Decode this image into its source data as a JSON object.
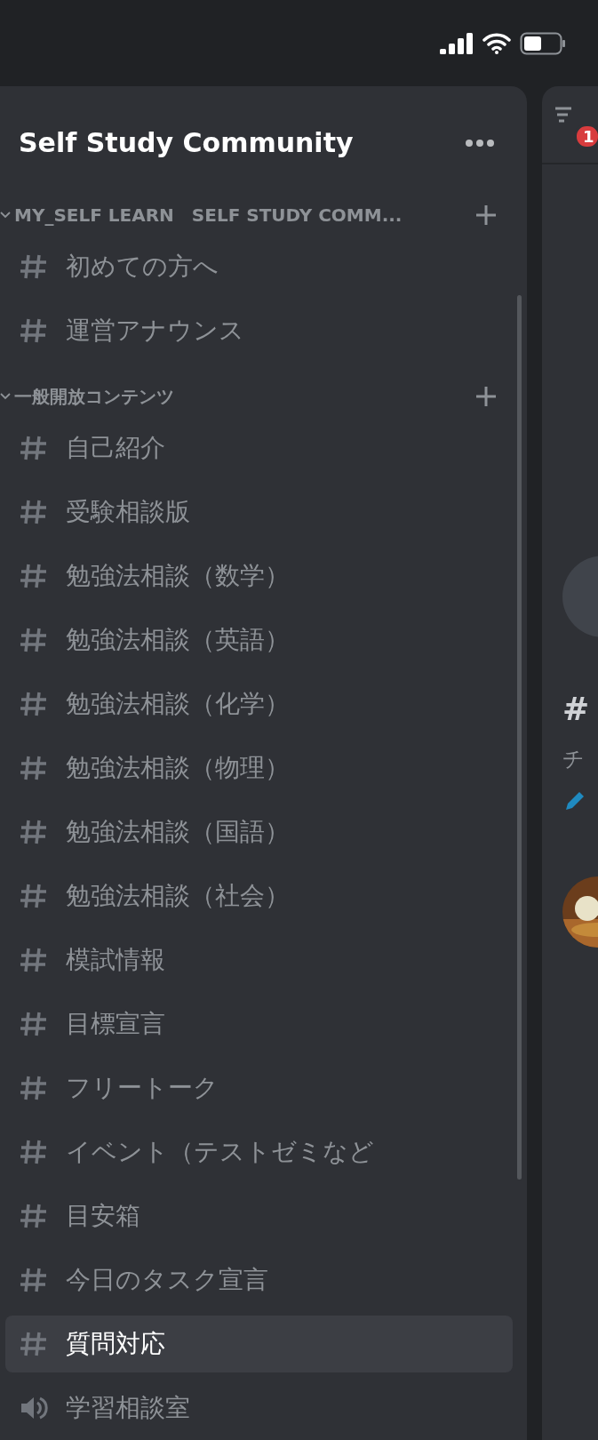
{
  "server": {
    "name": "Self Study Community"
  },
  "categories": [
    {
      "name": "MY_SELF LEARN　SELF STUDY COMM...",
      "expanded": true,
      "channels": [
        {
          "kind": "text",
          "name": "初めての方へ",
          "selected": false
        },
        {
          "kind": "text",
          "name": "運営アナウンス",
          "selected": false
        }
      ]
    },
    {
      "name": "一般開放コンテンツ",
      "expanded": true,
      "channels": [
        {
          "kind": "text",
          "name": "自己紹介",
          "selected": false
        },
        {
          "kind": "text",
          "name": "受験相談版",
          "selected": false
        },
        {
          "kind": "text",
          "name": "勉強法相談（数学）",
          "selected": false
        },
        {
          "kind": "text",
          "name": "勉強法相談（英語）",
          "selected": false
        },
        {
          "kind": "text",
          "name": "勉強法相談（化学）",
          "selected": false
        },
        {
          "kind": "text",
          "name": "勉強法相談（物理）",
          "selected": false
        },
        {
          "kind": "text",
          "name": "勉強法相談（国語）",
          "selected": false
        },
        {
          "kind": "text",
          "name": "勉強法相談（社会）",
          "selected": false
        },
        {
          "kind": "text",
          "name": "模試情報",
          "selected": false
        },
        {
          "kind": "text",
          "name": "目標宣言",
          "selected": false
        },
        {
          "kind": "text",
          "name": "フリートーク",
          "selected": false
        },
        {
          "kind": "text",
          "name": "イベント（テストゼミなど",
          "selected": false
        },
        {
          "kind": "text",
          "name": "目安箱",
          "selected": false
        },
        {
          "kind": "text",
          "name": "今日のタスク宣言",
          "selected": false
        },
        {
          "kind": "text",
          "name": "質問対応",
          "selected": true
        },
        {
          "kind": "voice",
          "name": "学習相談室",
          "selected": false
        }
      ]
    }
  ],
  "channel_panel": {
    "badge": "1",
    "title": "#",
    "subtitle": "チ"
  }
}
